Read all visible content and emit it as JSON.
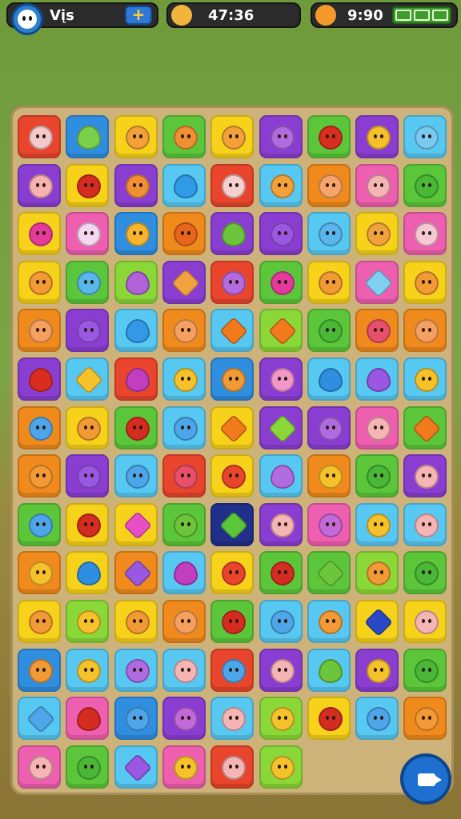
{
  "hud": {
    "player_name": "Vįs",
    "timer": "47:36",
    "currency": "9:90",
    "add_button_label": "+",
    "avatar_icon": "face-icon",
    "timer_icon": "banana-icon",
    "currency_icon": "bag-icon",
    "menu_icon": "grid-icon",
    "camera_icon": "camera-icon"
  },
  "colors": {
    "red": "#e8452c",
    "blue": "#2f8ee0",
    "yellow": "#f7d21a",
    "green": "#5cc63a",
    "purple": "#8a3ed1",
    "orange": "#f08a1c",
    "pink": "#ee5fb0",
    "cyan": "#57c8f2",
    "navy": "#1f2f8a",
    "lime": "#8ad838"
  },
  "board": {
    "rows": [
      [
        {
          "bg": "red",
          "fg": "#f4c9c9",
          "shape": "face"
        },
        {
          "bg": "blue",
          "fg": "#7ad04a",
          "shape": "drop"
        },
        {
          "bg": "yellow",
          "fg": "#f3a23a",
          "shape": "face"
        },
        {
          "bg": "green",
          "fg": "#f08f33",
          "shape": "face"
        },
        {
          "bg": "yellow",
          "fg": "#f3a23a",
          "shape": "face"
        },
        {
          "bg": "purple",
          "fg": "#b06be0",
          "shape": "face"
        },
        {
          "bg": "green",
          "fg": "#d92d20",
          "shape": "face"
        },
        {
          "bg": "purple",
          "fg": "#f5c02c",
          "shape": "face"
        },
        {
          "bg": "cyan",
          "fg": "#79c9f0",
          "shape": "face"
        }
      ],
      [
        {
          "bg": "purple",
          "fg": "#f6b1b0",
          "shape": "face"
        },
        {
          "bg": "yellow",
          "fg": "#d52c22",
          "shape": "face"
        },
        {
          "bg": "purple",
          "fg": "#f08f33",
          "shape": "face"
        },
        {
          "bg": "cyan",
          "fg": "#2f9ae6",
          "shape": "drop"
        },
        {
          "bg": "red",
          "fg": "#f6d0d0",
          "shape": "face"
        },
        {
          "bg": "cyan",
          "fg": "#f3a23a",
          "shape": "face"
        },
        {
          "bg": "orange",
          "fg": "#f6a56a",
          "shape": "face"
        },
        {
          "bg": "pink",
          "fg": "#f6b5b5",
          "shape": "face"
        },
        {
          "bg": "green",
          "fg": "#49b935",
          "shape": "face"
        }
      ],
      [
        {
          "bg": "yellow",
          "fg": "#e43a9c",
          "shape": "face"
        },
        {
          "bg": "pink",
          "fg": "#f3d8f0",
          "shape": "face"
        },
        {
          "bg": "blue",
          "fg": "#f6b52c",
          "shape": "face"
        },
        {
          "bg": "orange",
          "fg": "#e7661c",
          "shape": "face"
        },
        {
          "bg": "purple",
          "fg": "#6cc53a",
          "shape": "drop"
        },
        {
          "bg": "purple",
          "fg": "#9a57e2",
          "shape": "face"
        },
        {
          "bg": "cyan",
          "fg": "#5ab5ec",
          "shape": "face"
        },
        {
          "bg": "yellow",
          "fg": "#f0a23d",
          "shape": "face"
        },
        {
          "bg": "pink",
          "fg": "#f5c8d4",
          "shape": "face"
        }
      ],
      [
        {
          "bg": "yellow",
          "fg": "#f29a35",
          "shape": "face"
        },
        {
          "bg": "green",
          "fg": "#56b9ea",
          "shape": "face"
        },
        {
          "bg": "lime",
          "fg": "#b062d8",
          "shape": "drop"
        },
        {
          "bg": "purple",
          "fg": "#f2a340",
          "shape": "gem"
        },
        {
          "bg": "red",
          "fg": "#b46be0",
          "shape": "face"
        },
        {
          "bg": "green",
          "fg": "#e23b9c",
          "shape": "face"
        },
        {
          "bg": "yellow",
          "fg": "#f29a35",
          "shape": "face"
        },
        {
          "bg": "pink",
          "fg": "#7fd0f3",
          "shape": "gem"
        },
        {
          "bg": "yellow",
          "fg": "#f29a35",
          "shape": "face"
        }
      ],
      [
        {
          "bg": "orange",
          "fg": "#f6a060",
          "shape": "face"
        },
        {
          "bg": "purple",
          "fg": "#9a57e2",
          "shape": "face"
        },
        {
          "bg": "cyan",
          "fg": "#3498e6",
          "shape": "drop"
        },
        {
          "bg": "orange",
          "fg": "#f6a060",
          "shape": "face"
        },
        {
          "bg": "cyan",
          "fg": "#f07a1c",
          "shape": "gem"
        },
        {
          "bg": "lime",
          "fg": "#f07a1c",
          "shape": "gem"
        },
        {
          "bg": "green",
          "fg": "#4ab737",
          "shape": "face"
        },
        {
          "bg": "orange",
          "fg": "#e84f6a",
          "shape": "face"
        },
        {
          "bg": "orange",
          "fg": "#f6a060",
          "shape": "face"
        }
      ],
      [
        {
          "bg": "purple",
          "fg": "#d92d20",
          "shape": "drop"
        },
        {
          "bg": "cyan",
          "fg": "#f6c22c",
          "shape": "gem"
        },
        {
          "bg": "red",
          "fg": "#c23ec0",
          "shape": "drop"
        },
        {
          "bg": "cyan",
          "fg": "#f6c22c",
          "shape": "face"
        },
        {
          "bg": "blue",
          "fg": "#f29a35",
          "shape": "face"
        },
        {
          "bg": "purple",
          "fg": "#f198c9",
          "shape": "face"
        },
        {
          "bg": "cyan",
          "fg": "#2f8ee0",
          "shape": "drop"
        },
        {
          "bg": "cyan",
          "fg": "#9a57e2",
          "shape": "drop"
        },
        {
          "bg": "cyan",
          "fg": "#f6c22c",
          "shape": "face"
        }
      ],
      [
        {
          "bg": "orange",
          "fg": "#4ea6ea",
          "shape": "face"
        },
        {
          "bg": "yellow",
          "fg": "#f29a35",
          "shape": "face"
        },
        {
          "bg": "green",
          "fg": "#d52c22",
          "shape": "face"
        },
        {
          "bg": "cyan",
          "fg": "#4ea6ea",
          "shape": "face"
        },
        {
          "bg": "yellow",
          "fg": "#f07a1c",
          "shape": "gem"
        },
        {
          "bg": "purple",
          "fg": "#8ad838",
          "shape": "gem"
        },
        {
          "bg": "purple",
          "fg": "#b06be0",
          "shape": "face"
        },
        {
          "bg": "pink",
          "fg": "#f6b5b5",
          "shape": "face"
        },
        {
          "bg": "green",
          "fg": "#f07a1c",
          "shape": "gem"
        }
      ],
      [
        {
          "bg": "orange",
          "fg": "#f29a35",
          "shape": "face"
        },
        {
          "bg": "purple",
          "fg": "#9a57e2",
          "shape": "face"
        },
        {
          "bg": "cyan",
          "fg": "#4ea6ea",
          "shape": "face"
        },
        {
          "bg": "red",
          "fg": "#e84f6a",
          "shape": "face"
        },
        {
          "bg": "yellow",
          "fg": "#e8452c",
          "shape": "face"
        },
        {
          "bg": "cyan",
          "fg": "#b06be0",
          "shape": "drop"
        },
        {
          "bg": "orange",
          "fg": "#f6c22c",
          "shape": "face"
        },
        {
          "bg": "green",
          "fg": "#4ab737",
          "shape": "face"
        },
        {
          "bg": "purple",
          "fg": "#f6b5b5",
          "shape": "face"
        }
      ],
      [
        {
          "bg": "green",
          "fg": "#4ea6ea",
          "shape": "face"
        },
        {
          "bg": "yellow",
          "fg": "#d52c22",
          "shape": "face"
        },
        {
          "bg": "yellow",
          "fg": "#e84fc6",
          "shape": "gem"
        },
        {
          "bg": "green",
          "fg": "#6cc53a",
          "shape": "face"
        },
        {
          "bg": "navy",
          "fg": "#5cc63a",
          "shape": "gem"
        },
        {
          "bg": "purple",
          "fg": "#f6b5b5",
          "shape": "face"
        },
        {
          "bg": "pink",
          "fg": "#c46ad8",
          "shape": "face"
        },
        {
          "bg": "cyan",
          "fg": "#f6c22c",
          "shape": "face"
        },
        {
          "bg": "cyan",
          "fg": "#f6b5b5",
          "shape": "face"
        }
      ],
      [
        {
          "bg": "orange",
          "fg": "#f6c22c",
          "shape": "face"
        },
        {
          "bg": "yellow",
          "fg": "#2f8ee0",
          "shape": "drop"
        },
        {
          "bg": "orange",
          "fg": "#9a57e2",
          "shape": "gem"
        },
        {
          "bg": "cyan",
          "fg": "#c23ec0",
          "shape": "drop"
        },
        {
          "bg": "yellow",
          "fg": "#e8452c",
          "shape": "face"
        },
        {
          "bg": "green",
          "fg": "#d52c22",
          "shape": "face"
        },
        {
          "bg": "green",
          "fg": "#6cc53a",
          "shape": "gem"
        },
        {
          "bg": "lime",
          "fg": "#f29a35",
          "shape": "face"
        },
        {
          "bg": "green",
          "fg": "#4ab737",
          "shape": "face"
        }
      ],
      [
        {
          "bg": "yellow",
          "fg": "#f29a35",
          "shape": "face"
        },
        {
          "bg": "lime",
          "fg": "#f6c22c",
          "shape": "face"
        },
        {
          "bg": "yellow",
          "fg": "#f29a35",
          "shape": "face"
        },
        {
          "bg": "orange",
          "fg": "#f6a060",
          "shape": "face"
        },
        {
          "bg": "green",
          "fg": "#d52c22",
          "shape": "face"
        },
        {
          "bg": "cyan",
          "fg": "#4ea6ea",
          "shape": "face"
        },
        {
          "bg": "cyan",
          "fg": "#f29a35",
          "shape": "face"
        },
        {
          "bg": "yellow",
          "fg": "#2a49c8",
          "shape": "gem"
        },
        {
          "bg": "yellow",
          "fg": "#f6b5b5",
          "shape": "face"
        }
      ],
      [
        {
          "bg": "blue",
          "fg": "#f29a35",
          "shape": "face"
        },
        {
          "bg": "cyan",
          "fg": "#f6c22c",
          "shape": "face"
        },
        {
          "bg": "cyan",
          "fg": "#b06be0",
          "shape": "face"
        },
        {
          "bg": "cyan",
          "fg": "#f6b5b5",
          "shape": "face"
        },
        {
          "bg": "red",
          "fg": "#4ea6ea",
          "shape": "face"
        },
        {
          "bg": "purple",
          "fg": "#f6b5b5",
          "shape": "face"
        },
        {
          "bg": "cyan",
          "fg": "#6cc53a",
          "shape": "drop"
        },
        {
          "bg": "purple",
          "fg": "#f6c22c",
          "shape": "face"
        },
        {
          "bg": "green",
          "fg": "#4ab737",
          "shape": "face"
        }
      ],
      [
        {
          "bg": "cyan",
          "fg": "#4ea6ea",
          "shape": "gem"
        },
        {
          "bg": "pink",
          "fg": "#d52c22",
          "shape": "drop"
        },
        {
          "bg": "blue",
          "fg": "#4ea6ea",
          "shape": "face"
        },
        {
          "bg": "purple",
          "fg": "#c46ad8",
          "shape": "face"
        },
        {
          "bg": "cyan",
          "fg": "#f6b5b5",
          "shape": "face"
        },
        {
          "bg": "lime",
          "fg": "#f6c22c",
          "shape": "face"
        },
        {
          "bg": "yellow",
          "fg": "#d52c22",
          "shape": "face"
        },
        {
          "bg": "cyan",
          "fg": "#4ea6ea",
          "shape": "face"
        },
        {
          "bg": "orange",
          "fg": "#f29a35",
          "shape": "face"
        }
      ],
      [
        {
          "bg": "pink",
          "fg": "#f6b5b5",
          "shape": "face"
        },
        {
          "bg": "green",
          "fg": "#4ab737",
          "shape": "face"
        },
        {
          "bg": "cyan",
          "fg": "#9a57e2",
          "shape": "gem"
        },
        {
          "bg": "pink",
          "fg": "#f6c22c",
          "shape": "face"
        },
        {
          "bg": "red",
          "fg": "#f6b5b5",
          "shape": "face"
        },
        {
          "bg": "lime",
          "fg": "#f6c22c",
          "shape": "face"
        }
      ]
    ]
  }
}
